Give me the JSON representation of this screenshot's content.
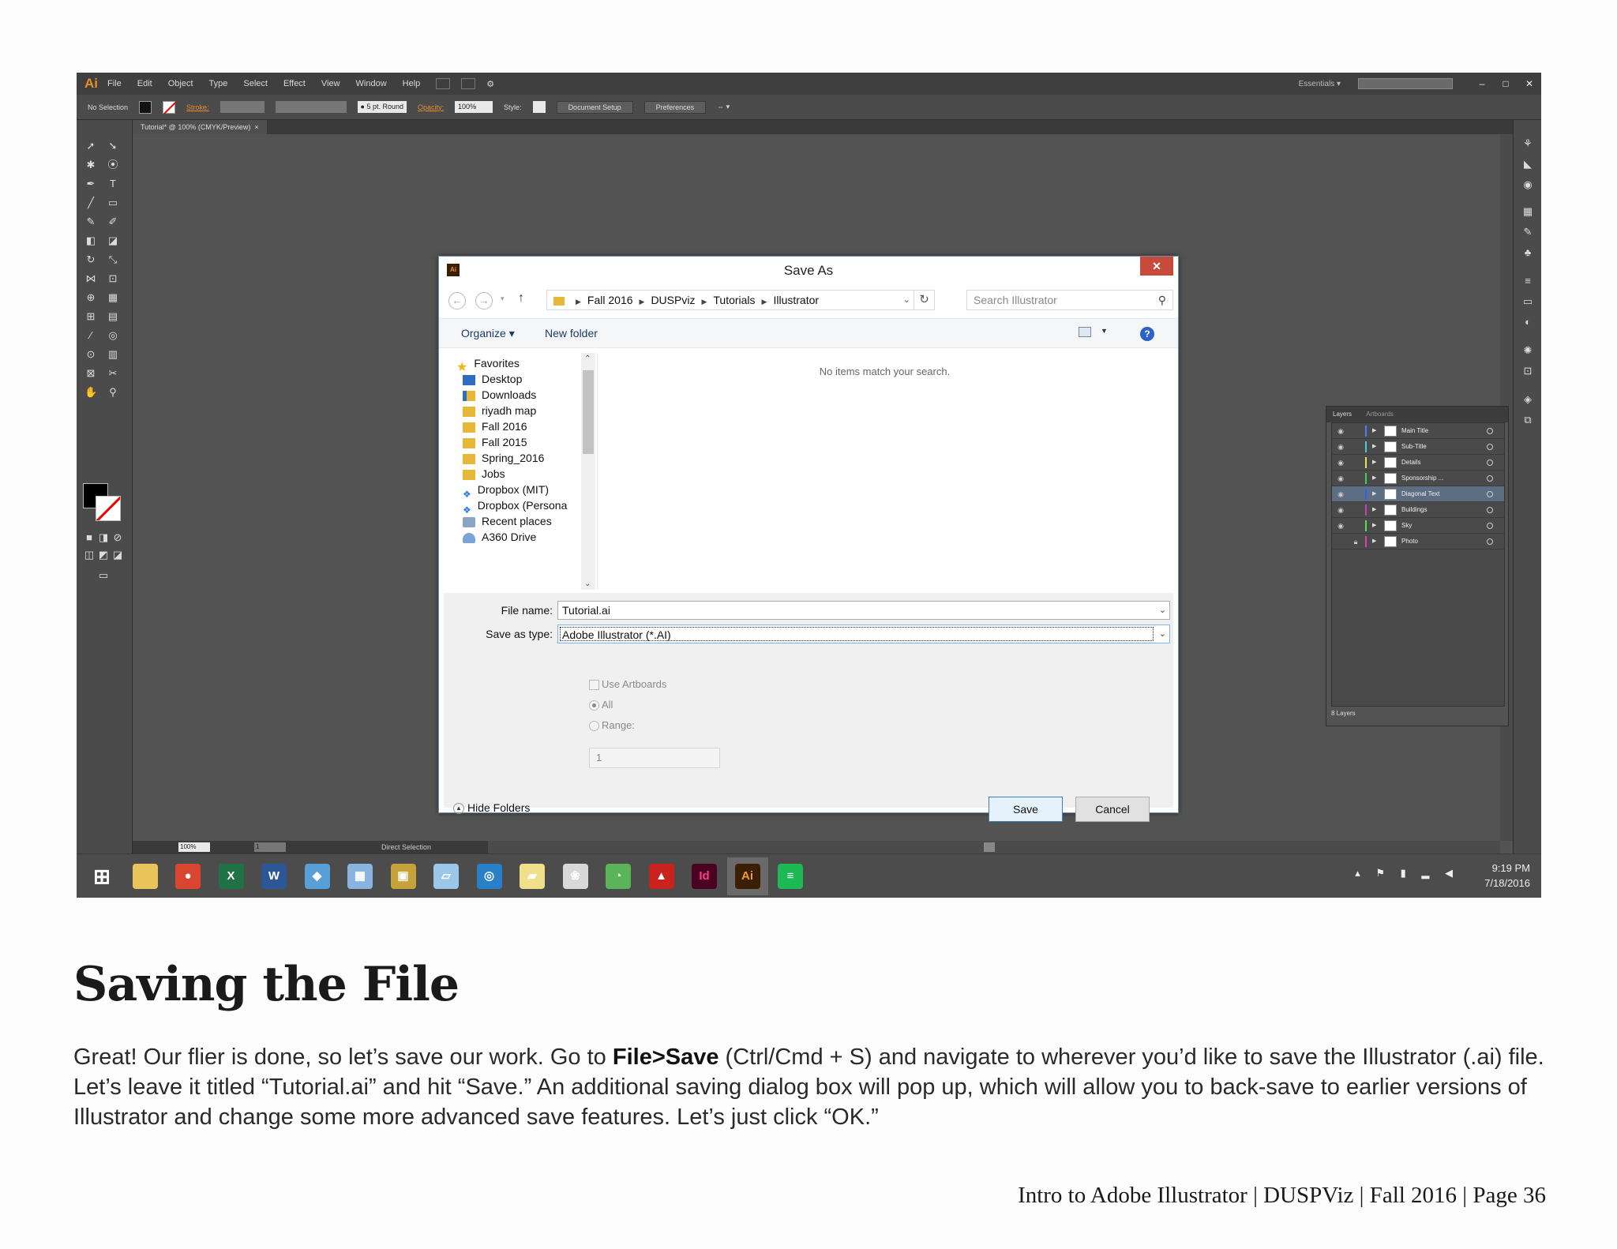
{
  "app": {
    "logo": "Ai",
    "menus": [
      "File",
      "Edit",
      "Object",
      "Type",
      "Select",
      "Effect",
      "View",
      "Window",
      "Help"
    ],
    "workspace": "Essentials",
    "window_controls": [
      "–",
      "□",
      "✕"
    ]
  },
  "control_bar": {
    "selection": "No Selection",
    "stroke_label": "Stroke:",
    "brush": "5 pt. Round",
    "opacity_label": "Opacity:",
    "opacity_value": "100%",
    "style_label": "Style:",
    "document_setup": "Document Setup",
    "preferences": "Preferences"
  },
  "document_tab": "Tutorial* @ 100% (CMYK/Preview)",
  "status_bar": {
    "zoom": "100%",
    "artboard": "1",
    "tool": "Direct Selection"
  },
  "dialog": {
    "title": "Save As",
    "close": "✕",
    "breadcrumb": [
      "Fall 2016",
      "DUSPviz",
      "Tutorials",
      "Illustrator"
    ],
    "search_placeholder": "Search Illustrator",
    "organize": "Organize ▾",
    "new_folder": "New folder",
    "help": "?",
    "nav_items": [
      {
        "label": "Favorites",
        "icon": "star-icon"
      },
      {
        "label": "Desktop",
        "icon": "desktop-icon"
      },
      {
        "label": "Downloads",
        "icon": "downloads-icon"
      },
      {
        "label": "riyadh map",
        "icon": "folder-icon"
      },
      {
        "label": "Fall 2016",
        "icon": "folder-icon"
      },
      {
        "label": "Fall 2015",
        "icon": "folder-icon"
      },
      {
        "label": "Spring_2016",
        "icon": "folder-icon"
      },
      {
        "label": "Jobs",
        "icon": "folder-icon"
      },
      {
        "label": "Dropbox (MIT)",
        "icon": "dropbox-icon"
      },
      {
        "label": "Dropbox (Persona",
        "icon": "dropbox-icon"
      },
      {
        "label": "Recent places",
        "icon": "recent-places-icon"
      },
      {
        "label": "A360 Drive",
        "icon": "cloud-drive-icon"
      }
    ],
    "empty_message": "No items match your search.",
    "file_name_label": "File name:",
    "file_name_value": "Tutorial.ai",
    "save_type_label": "Save as type:",
    "save_type_value": "Adobe Illustrator (*.AI)",
    "use_artboards": "Use Artboards",
    "all": "All",
    "range": "Range:",
    "range_value": "1",
    "hide_folders": "Hide Folders",
    "save": "Save",
    "cancel": "Cancel"
  },
  "layers_panel": {
    "tabs": [
      "Layers",
      "Artboards"
    ],
    "layers": [
      {
        "name": "Main Title",
        "color": "#4f7dff"
      },
      {
        "name": "Sub-Title",
        "color": "#3ad0e0"
      },
      {
        "name": "Details",
        "color": "#f0e040"
      },
      {
        "name": "Sponsorship ...",
        "color": "#3ad060"
      },
      {
        "name": "Diagonal Text",
        "color": "#2f60ff"
      },
      {
        "name": "Buildings",
        "color": "#c040c0"
      },
      {
        "name": "Sky",
        "color": "#50e050"
      },
      {
        "name": "Photo",
        "color": "#e040a0"
      }
    ],
    "count": "8 Layers"
  },
  "taskbar": {
    "apps": [
      {
        "name": "windows-start-icon",
        "glyph": "⊞",
        "color": "#4c4c4c"
      },
      {
        "name": "file-explorer-icon",
        "glyph": "",
        "color": "#e8c45a"
      },
      {
        "name": "chrome-icon",
        "glyph": "●",
        "color": "#d9452f"
      },
      {
        "name": "excel-icon",
        "glyph": "X",
        "color": "#207245"
      },
      {
        "name": "word-icon",
        "glyph": "W",
        "color": "#2b5797"
      },
      {
        "name": "app-diamond-icon",
        "glyph": "◆",
        "color": "#5aa0d8"
      },
      {
        "name": "calculator-icon",
        "glyph": "▦",
        "color": "#8ab4e0"
      },
      {
        "name": "package-icon",
        "glyph": "▣",
        "color": "#c7a23a"
      },
      {
        "name": "notes-icon",
        "glyph": "▱",
        "color": "#9cc7e8"
      },
      {
        "name": "magnifier-app-icon",
        "glyph": "◎",
        "color": "#2a7fc9"
      },
      {
        "name": "sticky-notes-icon",
        "glyph": "▰",
        "color": "#f0e08a"
      },
      {
        "name": "paint-icon",
        "glyph": "❀",
        "color": "#d8d8d8"
      },
      {
        "name": "browser-globe-icon",
        "glyph": "◔",
        "color": "#5ab45a"
      },
      {
        "name": "acrobat-icon",
        "glyph": "▲",
        "color": "#c8231c"
      },
      {
        "name": "indesign-icon",
        "glyph": "Id",
        "color": "#49021f"
      },
      {
        "name": "illustrator-icon",
        "glyph": "Ai",
        "color": "#3a1f05"
      },
      {
        "name": "spotify-icon",
        "glyph": "≡",
        "color": "#1db954"
      }
    ],
    "time": "9:19 PM",
    "date": "7/18/2016"
  },
  "page": {
    "heading": "Saving the File",
    "para_1": "Great! Our flier is done, so let’s save our work. Go to ",
    "para_bold": "File>Save",
    "para_2": " (Ctrl/Cmd + S) and navigate to wherever you’d like to save the Illustrator (.ai) file. Let’s leave it titled “Tutorial.ai” and hit “Save.” An additional saving dialog box will pop up, which will allow you to back-save to earlier versions of Illustrator and change some more advanced save features. Let’s just click “OK.”",
    "footer": "Intro to Adobe Illustrator | DUSPViz | Fall 2016 | Page 36"
  }
}
